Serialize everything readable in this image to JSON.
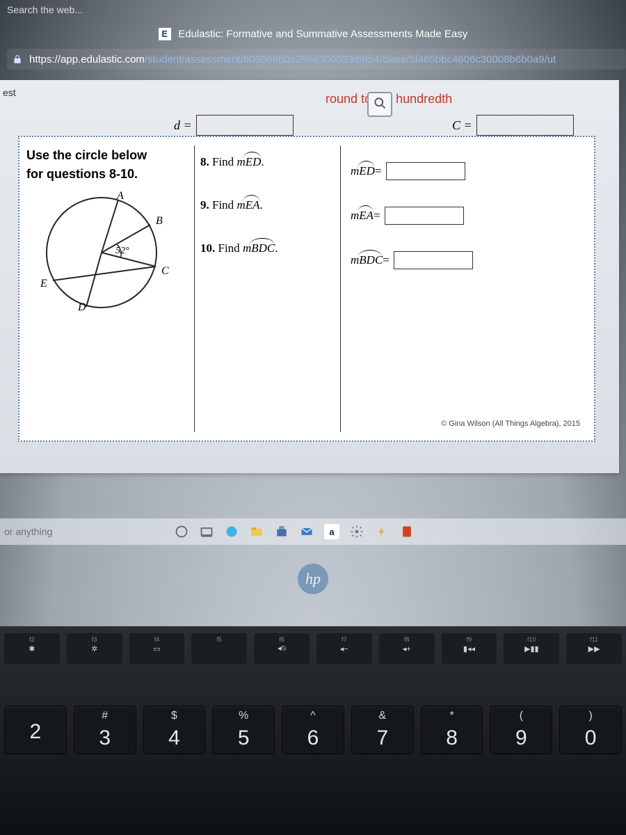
{
  "browser": {
    "partial_tab": "Search the web...",
    "page_title": "Edulastic: Formative and Summative Assessments Made Easy",
    "favicon_letter": "E",
    "url_host": "https://app.edulastic.com",
    "url_path": "/student/assessment/609566b0e296e300093d9fb4/class/5f465bbc4606c30008b6b0a9/ut"
  },
  "page": {
    "crumb": "est",
    "round_hint": "round to the hundredth",
    "d_eq": "d =",
    "c_eq": "C =",
    "col1_heading_l1": "Use the circle below",
    "col1_heading_l2": "for questions 8-10.",
    "circle": {
      "A": "A",
      "B": "B",
      "C": "C",
      "D": "D",
      "E": "E",
      "angle": "52°"
    },
    "q8": {
      "num": "8.",
      "text": "Find ",
      "var": "mED",
      "suffix": "."
    },
    "q9": {
      "num": "9.",
      "text": "Find ",
      "var": "mEA",
      "suffix": "."
    },
    "q10": {
      "num": "10.",
      "text": "Find ",
      "var": "mBDC",
      "suffix": "."
    },
    "ans8": {
      "var": "mED",
      "eq": " ="
    },
    "ans9": {
      "var": "mEA",
      "eq": " ="
    },
    "ans10": {
      "var": "mBDC",
      "eq": " ="
    },
    "copyright": "© Gina Wilson (All Things Algebra), 2015"
  },
  "taskbar": {
    "search_placeholder": "or anything",
    "icons": [
      "cortana",
      "taskview",
      "edge",
      "explorer",
      "store",
      "mail",
      "amazon",
      "settings",
      "powerpoint",
      "word"
    ]
  },
  "hp_logo": "hp",
  "keyboard": {
    "frow": [
      {
        "sub": "f2",
        "sym": "✱"
      },
      {
        "sub": "f3",
        "sym": "✲"
      },
      {
        "sub": "f4",
        "sym": "▭"
      },
      {
        "sub": "f5",
        "sym": ""
      },
      {
        "sub": "f6",
        "sym": "◂⍉"
      },
      {
        "sub": "f7",
        "sym": "◂−"
      },
      {
        "sub": "f8",
        "sym": "◂+"
      },
      {
        "sub": "f9",
        "sym": "▮◂◂"
      },
      {
        "sub": "f10",
        "sym": "▶▮▮"
      },
      {
        "sub": "f11",
        "sym": "▶▶"
      }
    ],
    "numrow": [
      {
        "sym": "",
        "dig": "2"
      },
      {
        "sym": "#",
        "dig": "3"
      },
      {
        "sym": "$",
        "dig": "4"
      },
      {
        "sym": "%",
        "dig": "5"
      },
      {
        "sym": "^",
        "dig": "6"
      },
      {
        "sym": "&",
        "dig": "7"
      },
      {
        "sym": "*",
        "dig": "8"
      },
      {
        "sym": "(",
        "dig": "9"
      },
      {
        "sym": ")",
        "dig": "0"
      }
    ]
  }
}
